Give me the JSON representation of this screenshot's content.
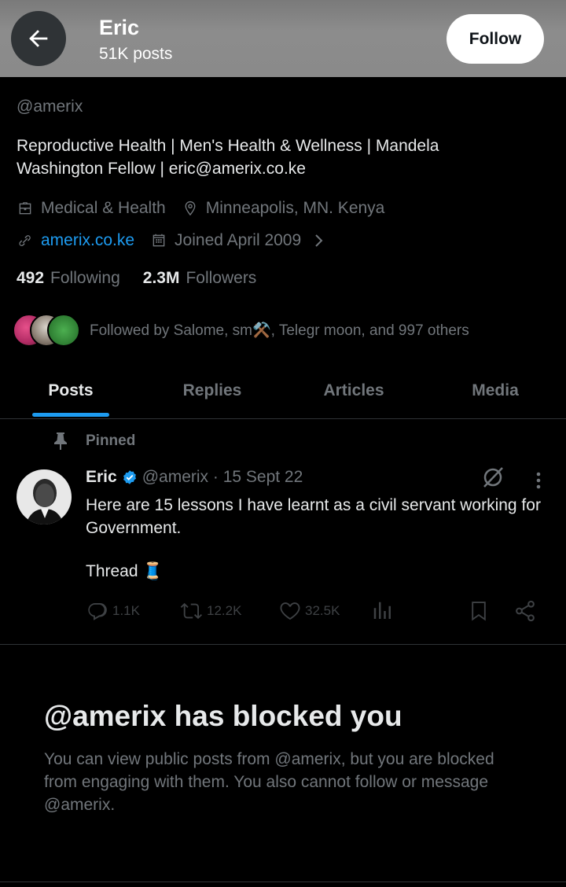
{
  "header": {
    "name": "Eric",
    "posts_count": "51K posts",
    "follow_label": "Follow"
  },
  "profile": {
    "handle": "@amerix",
    "bio": "Reproductive Health | Men's Health & Wellness | Mandela Washington Fellow | eric@amerix.co.ke",
    "category": "Medical & Health",
    "location": "Minneapolis, MN. Kenya",
    "website": "amerix.co.ke",
    "joined": "Joined April 2009",
    "following_count": "492",
    "following_label": "Following",
    "followers_count": "2.3M",
    "followers_label": "Followers",
    "followed_by": "Followed by Salome, sm⚒️, Telegr moon, and 997 others"
  },
  "tabs": [
    {
      "label": "Posts",
      "active": true
    },
    {
      "label": "Replies",
      "active": false
    },
    {
      "label": "Articles",
      "active": false
    },
    {
      "label": "Media",
      "active": false
    }
  ],
  "pinned_post": {
    "pinned_label": "Pinned",
    "author": "Eric",
    "handle_date": "@amerix · 15 Sept 22",
    "text": "Here are 15 lessons I have learnt as a civil servant working for Government.",
    "thread": "Thread 🧵",
    "replies": "1.1K",
    "reposts": "12.2K",
    "likes": "32.5K"
  },
  "blocked": {
    "title": "@amerix has blocked you",
    "body": "You can view public posts from @amerix, but you are blocked from engaging with them. You also cannot follow or message @amerix."
  },
  "colors": {
    "accent": "#1d9bf0",
    "muted": "#71767b",
    "text": "#e7e9ea",
    "background": "#000000"
  }
}
